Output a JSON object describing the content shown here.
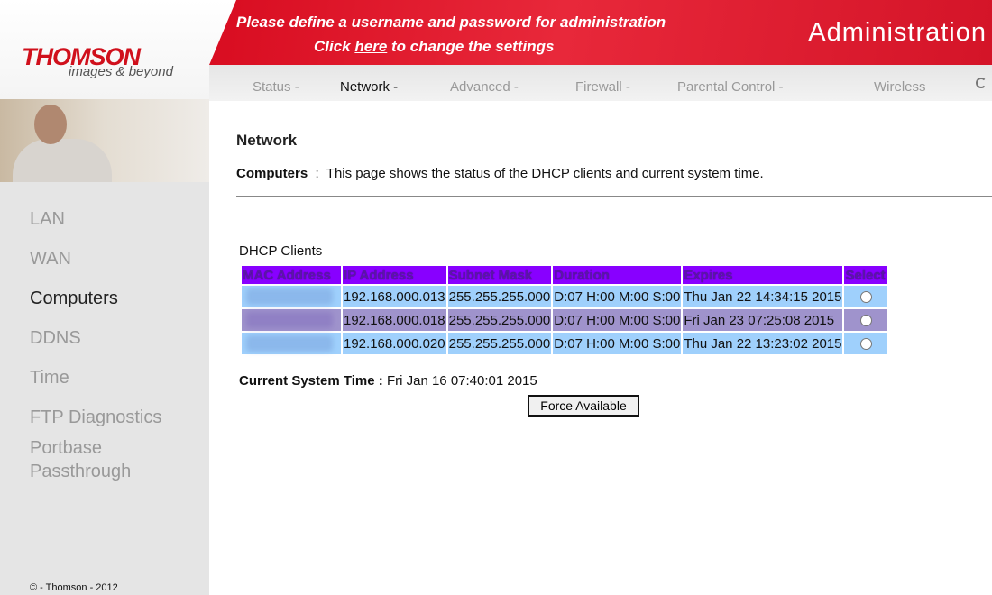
{
  "logo": {
    "brand": "THOMSON",
    "tagline": "images & beyond"
  },
  "banner": {
    "line1": "Please define a username and password for administration",
    "line2_pre": "Click ",
    "link": "here",
    "line2_post": " to change the settings",
    "title": "Administration"
  },
  "nav": [
    "Status -",
    "Network -",
    "Advanced -",
    "Firewall -",
    "Parental Control -",
    "Wireless"
  ],
  "sidebar": {
    "items": [
      "LAN",
      "WAN",
      "Computers",
      "DDNS",
      "Time",
      "FTP Diagnostics",
      "Portbase",
      "Passthrough"
    ],
    "copyright": "© - Thomson - 2012"
  },
  "page": {
    "title": "Network",
    "section": "Computers",
    "separator": ":",
    "description": "This page shows the status of the DHCP clients and current system time."
  },
  "dhcp": {
    "caption": "DHCP Clients",
    "headers": [
      "MAC Address",
      "IP Address",
      "Subnet Mask",
      "Duration",
      "Expires",
      "Select"
    ],
    "rows": [
      {
        "ip": "192.168.000.013",
        "mask": "255.255.255.000",
        "duration": "D:07 H:00 M:00 S:00",
        "expires": "Thu Jan 22 14:34:15 2015"
      },
      {
        "ip": "192.168.000.018",
        "mask": "255.255.255.000",
        "duration": "D:07 H:00 M:00 S:00",
        "expires": "Fri Jan 23 07:25:08 2015"
      },
      {
        "ip": "192.168.000.020",
        "mask": "255.255.255.000",
        "duration": "D:07 H:00 M:00 S:00",
        "expires": "Thu Jan 22 13:23:02 2015"
      }
    ]
  },
  "system_time": {
    "label": "Current System Time :",
    "value": "Fri Jan 16 07:40:01 2015"
  },
  "force_button": "Force Available",
  "colors": {
    "banner": "#d80c20",
    "header": "#8800ff",
    "row_blue": "#9fd0fc",
    "row_purple": "#9f93cc"
  }
}
